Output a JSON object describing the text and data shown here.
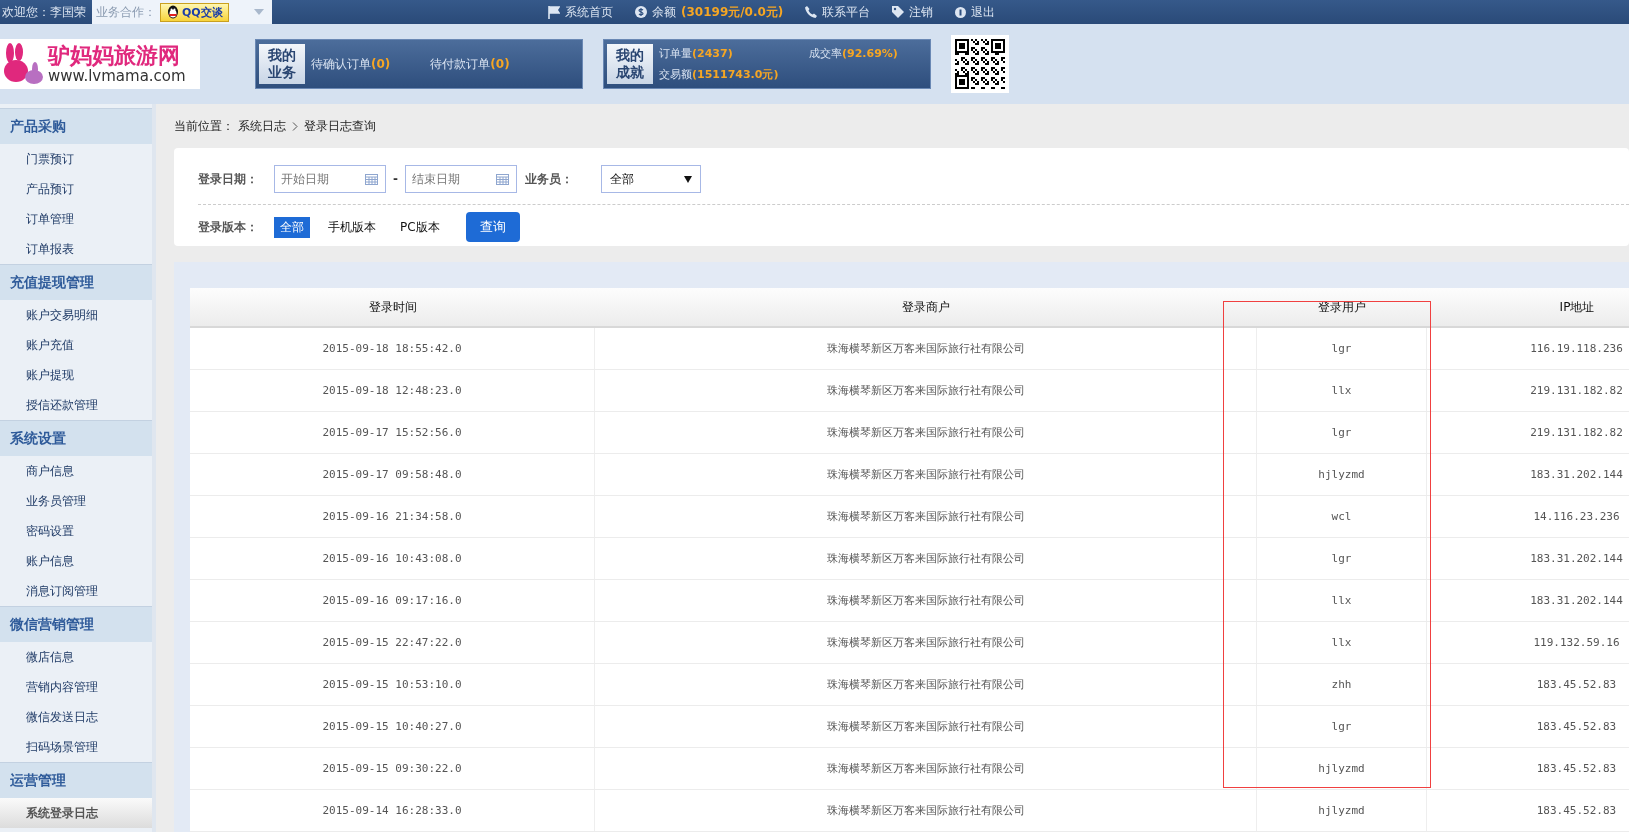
{
  "top_bar": {
    "welcome": "欢迎您：李国荣",
    "partner_label": "业务合作：",
    "qq_button": "QQ交谈",
    "links": [
      {
        "kind": "flag",
        "label": "系统首页"
      },
      {
        "kind": "balance",
        "label": "余额",
        "value": "(30199元/0.0元)"
      },
      {
        "kind": "phone",
        "label": "联系平台"
      },
      {
        "kind": "tag",
        "label": "注销"
      },
      {
        "kind": "exit",
        "label": "退出"
      }
    ]
  },
  "header": {
    "logo": {
      "name": "驴妈妈旅游网",
      "url": "www.lvmama.com"
    },
    "business_panel": {
      "title_lines": [
        "我的",
        "业务"
      ],
      "items": [
        {
          "label": "待确认订单",
          "count": "(0)"
        },
        {
          "label": "待付款订单",
          "count": "(0)"
        }
      ]
    },
    "achievement_panel": {
      "title_lines": [
        "我的",
        "成就"
      ],
      "items": [
        {
          "label": "订单量",
          "value": "(2437)"
        },
        {
          "label": "成交率",
          "value": "(92.69%)"
        },
        {
          "label": "交易额",
          "value": "(1511743.0元)"
        }
      ]
    }
  },
  "sidebar": {
    "groups": [
      {
        "title": "产品采购",
        "items": [
          {
            "label": "门票预订",
            "selected": false
          },
          {
            "label": "产品预订",
            "selected": false
          },
          {
            "label": "订单管理",
            "selected": false
          },
          {
            "label": "订单报表",
            "selected": false
          }
        ]
      },
      {
        "title": "充值提现管理",
        "items": [
          {
            "label": "账户交易明细",
            "selected": false
          },
          {
            "label": "账户充值",
            "selected": false
          },
          {
            "label": "账户提现",
            "selected": false
          },
          {
            "label": "授信还款管理",
            "selected": false
          }
        ]
      },
      {
        "title": "系统设置",
        "items": [
          {
            "label": "商户信息",
            "selected": false
          },
          {
            "label": "业务员管理",
            "selected": false
          },
          {
            "label": "密码设置",
            "selected": false
          },
          {
            "label": "账户信息",
            "selected": false
          },
          {
            "label": "消息订阅管理",
            "selected": false
          }
        ]
      },
      {
        "title": "微信营销管理",
        "items": [
          {
            "label": "微店信息",
            "selected": false
          },
          {
            "label": "营销内容管理",
            "selected": false
          },
          {
            "label": "微信发送日志",
            "selected": false
          },
          {
            "label": "扫码场景管理",
            "selected": false
          }
        ]
      },
      {
        "title": "运营管理",
        "items": [
          {
            "label": "系统登录日志",
            "selected": true
          }
        ]
      }
    ]
  },
  "breadcrumb": {
    "label": "当前位置：",
    "path": [
      "系统日志",
      "登录日志查询"
    ]
  },
  "filters": {
    "date_label": "登录日期：",
    "start": {
      "placeholder": "开始日期"
    },
    "dash": "-",
    "end": {
      "placeholder": "结束日期"
    },
    "staff_label": "业务员：",
    "staff_value": "全部",
    "version_label": "登录版本：",
    "versions": [
      {
        "label": "全部",
        "selected": true
      },
      {
        "label": "手机版本",
        "selected": false
      },
      {
        "label": "PC版本",
        "selected": false
      }
    ],
    "query_button": "查询"
  },
  "table": {
    "columns": [
      {
        "label": "登录时间",
        "highlighted": false
      },
      {
        "label": "登录商户",
        "highlighted": false
      },
      {
        "label": "登录用户",
        "highlighted": true
      },
      {
        "label": "IP地址",
        "highlighted": false
      }
    ],
    "rows": [
      [
        "2015-09-18 18:55:42.0",
        "珠海横琴新区万客来国际旅行社有限公司",
        "lgr",
        "116.19.118.236"
      ],
      [
        "2015-09-18 12:48:23.0",
        "珠海横琴新区万客来国际旅行社有限公司",
        "llx",
        "219.131.182.82"
      ],
      [
        "2015-09-17 15:52:56.0",
        "珠海横琴新区万客来国际旅行社有限公司",
        "lgr",
        "219.131.182.82"
      ],
      [
        "2015-09-17 09:58:48.0",
        "珠海横琴新区万客来国际旅行社有限公司",
        "hjlyzmd",
        "183.31.202.144"
      ],
      [
        "2015-09-16 21:34:58.0",
        "珠海横琴新区万客来国际旅行社有限公司",
        "wcl",
        "14.116.23.236"
      ],
      [
        "2015-09-16 10:43:08.0",
        "珠海横琴新区万客来国际旅行社有限公司",
        "lgr",
        "183.31.202.144"
      ],
      [
        "2015-09-16 09:17:16.0",
        "珠海横琴新区万客来国际旅行社有限公司",
        "llx",
        "183.31.202.144"
      ],
      [
        "2015-09-15 22:47:22.0",
        "珠海横琴新区万客来国际旅行社有限公司",
        "llx",
        "119.132.59.16"
      ],
      [
        "2015-09-15 10:53:10.0",
        "珠海横琴新区万客来国际旅行社有限公司",
        "zhh",
        "183.45.52.83"
      ],
      [
        "2015-09-15 10:40:27.0",
        "珠海横琴新区万客来国际旅行社有限公司",
        "lgr",
        "183.45.52.83"
      ],
      [
        "2015-09-15 09:30:22.0",
        "珠海横琴新区万客来国际旅行社有限公司",
        "hjlyzmd",
        "183.45.52.83"
      ],
      [
        "2015-09-14 16:28:33.0",
        "珠海横琴新区万客来国际旅行社有限公司",
        "hjlyzmd",
        "183.45.52.83"
      ]
    ]
  }
}
